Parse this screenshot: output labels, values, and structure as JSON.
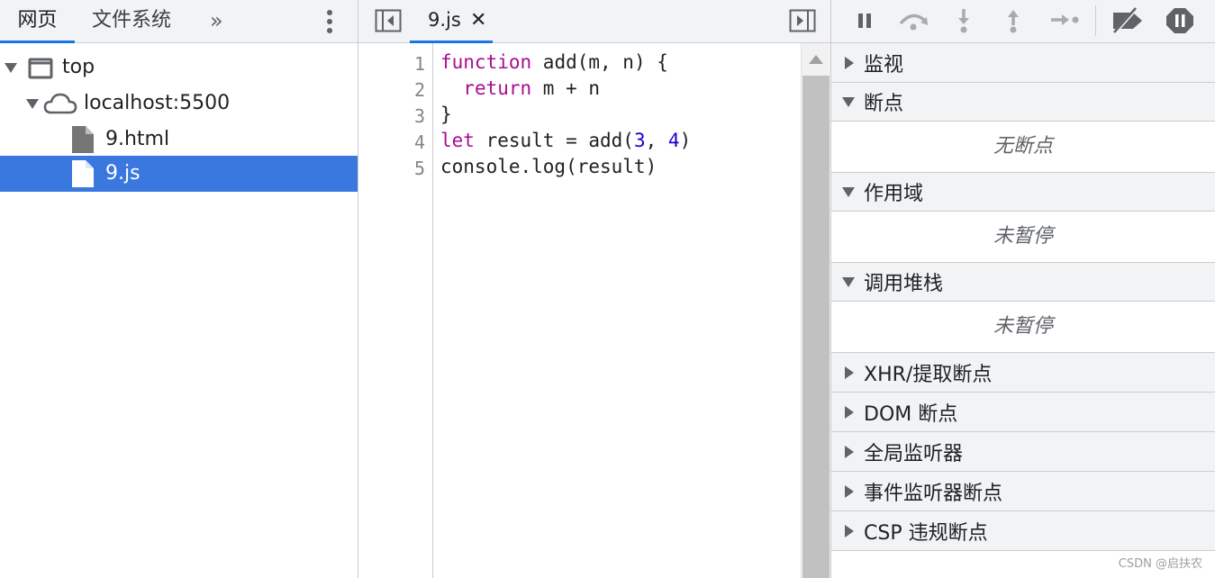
{
  "navigator": {
    "tabs": [
      "网页",
      "文件系统"
    ],
    "tree": [
      {
        "label": "top",
        "icon": "frame-icon"
      },
      {
        "label": "localhost:5500",
        "icon": "cloud-icon"
      },
      {
        "label": "9.html",
        "icon": "file-icon"
      },
      {
        "label": "9.js",
        "icon": "file-icon",
        "selected": true
      }
    ]
  },
  "editor": {
    "tab_label": "9.js",
    "line_numbers": [
      "1",
      "2",
      "3",
      "4",
      "5"
    ]
  },
  "debugger": {
    "sections": {
      "watch": "监视",
      "breakpoints": "断点",
      "breakpoints_empty": "无断点",
      "scope": "作用域",
      "scope_empty": "未暂停",
      "call_stack": "调用堆栈",
      "call_stack_empty": "未暂停",
      "xhr": "XHR/提取断点",
      "dom": "DOM 断点",
      "global_listeners": "全局监听器",
      "event_listener_bp": "事件监听器断点",
      "csp": "CSP 违规断点"
    }
  },
  "watermark": "CSDN @启扶农",
  "colors": {
    "accent": "#1a73e8",
    "selected_row": "#3a78e0",
    "keyword": "#aa0d91",
    "number": "#1c00cf"
  }
}
